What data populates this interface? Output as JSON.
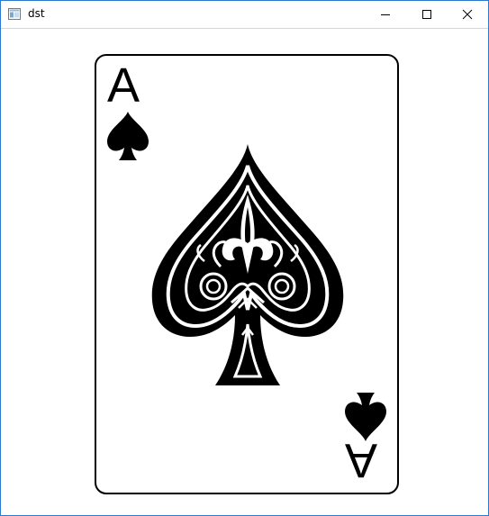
{
  "window": {
    "title": "dst",
    "icon": "app-window-icon",
    "controls": {
      "minimize": "minimize-icon",
      "maximize": "maximize-icon",
      "close": "close-icon"
    },
    "border_color": "#2b79d0"
  },
  "card": {
    "rank": "A",
    "suit": "spades",
    "suit_icon": "spade-icon",
    "center_art": "ornate-ace-of-spades",
    "ink_color": "#000000",
    "paper_color": "#ffffff"
  }
}
